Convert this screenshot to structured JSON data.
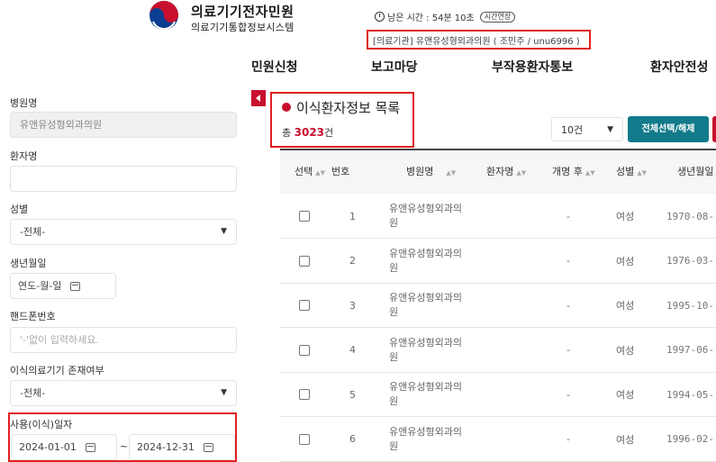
{
  "header": {
    "logo_title": "의료기기전자민원",
    "logo_subtitle": "의료기기통합정보시스템",
    "session_text": "남은 시간 : 54분 10초",
    "extend_label": "시간연장",
    "user_info": "[의료기관] 유앤유성형외과의원 ( 조민주 / unu6996 )"
  },
  "topnav": [
    "민원신청",
    "보고마당",
    "부작용환자통보",
    "환자안전성"
  ],
  "sidebar": {
    "hospital_label": "병원명",
    "hospital_value": "유앤유성형외과의원",
    "patient_label": "환자명",
    "patient_value": "",
    "gender_label": "성별",
    "gender_value": "-전체-",
    "birth_label": "생년월일",
    "birth_value": "연도-월-일",
    "phone_label": "핸드폰번호",
    "phone_placeholder": "'-'없이 입력하세요.",
    "device_label": "이식의료기기 존재여부",
    "device_value": "-전체-",
    "date_label": "사용(이식)일자",
    "date_from": "2024-01-01",
    "date_sep": "~",
    "date_to": "2024-12-31"
  },
  "main": {
    "title": "이식환자정보 목록",
    "total_prefix": "총",
    "total_count": "3023",
    "total_suffix": "건",
    "page_size": "10건",
    "select_all_label": "전체선택/해제"
  },
  "table": {
    "headers": [
      "선택",
      "번호",
      "병원명",
      "환자명",
      "개명 후",
      "성별",
      "생년월일"
    ],
    "rows": [
      {
        "no": "1",
        "hospital": "유앤유성형외과의원",
        "patient": "",
        "renamed": "-",
        "gender": "여성",
        "birth": "1970-08-"
      },
      {
        "no": "2",
        "hospital": "유앤유성형외과의원",
        "patient": "",
        "renamed": "-",
        "gender": "여성",
        "birth": "1976-03-"
      },
      {
        "no": "3",
        "hospital": "유앤유성형외과의원",
        "patient": "",
        "renamed": "-",
        "gender": "여성",
        "birth": "1995-10-"
      },
      {
        "no": "4",
        "hospital": "유앤유성형외과의원",
        "patient": "",
        "renamed": "-",
        "gender": "여성",
        "birth": "1997-06-"
      },
      {
        "no": "5",
        "hospital": "유앤유성형외과의원",
        "patient": "",
        "renamed": "-",
        "gender": "여성",
        "birth": "1994-05-"
      },
      {
        "no": "6",
        "hospital": "유앤유성형외과의원",
        "patient": "",
        "renamed": "-",
        "gender": "여성",
        "birth": "1996-02-"
      }
    ]
  },
  "colors": {
    "accent_red": "#c8102e",
    "teal_button": "#127a8a",
    "highlight_box": "#e02020"
  }
}
